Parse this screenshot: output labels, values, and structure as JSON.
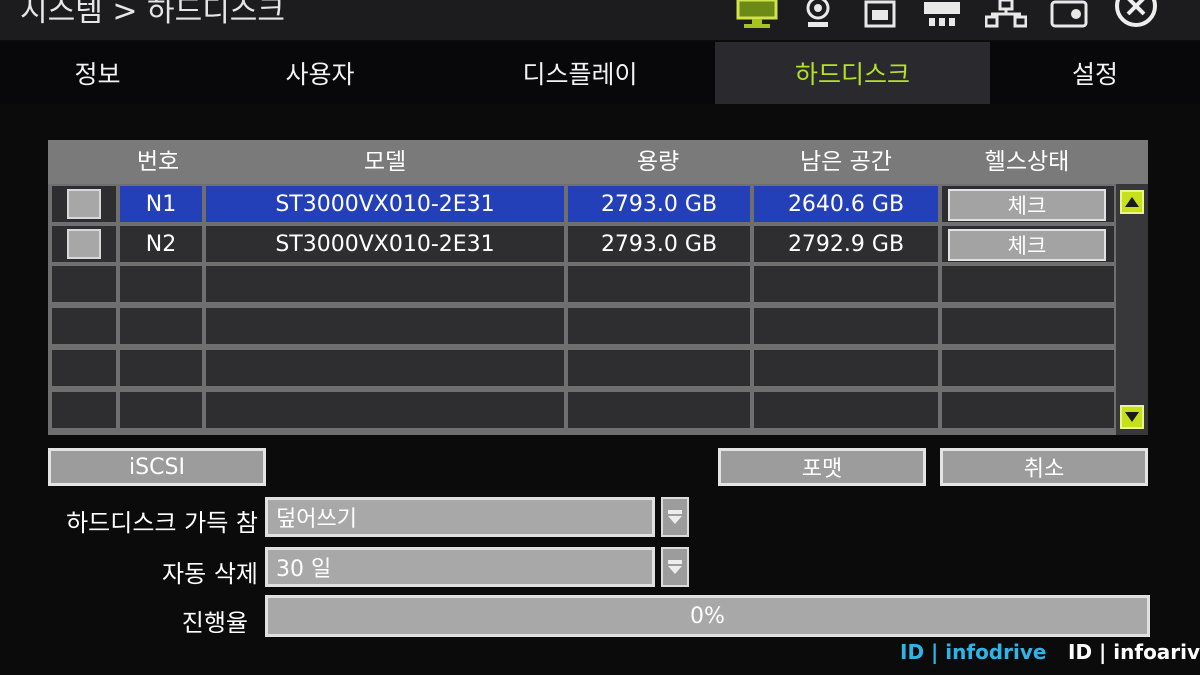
{
  "title": "시스템 > 하드디스크",
  "toolbar_icons": [
    "monitor-icon",
    "camera-icon",
    "recorder-icon",
    "network-card-icon",
    "network-icon",
    "storage-icon",
    "close-icon"
  ],
  "tabs": [
    {
      "label": "정보",
      "active": false
    },
    {
      "label": "사용자",
      "active": false
    },
    {
      "label": "디스플레이",
      "active": false
    },
    {
      "label": "하드디스크",
      "active": true
    },
    {
      "label": "설정",
      "active": false
    }
  ],
  "table": {
    "headers": [
      "",
      "번호",
      "모델",
      "용량",
      "남은 공간",
      "헬스상태"
    ],
    "rows": [
      {
        "num": "N1",
        "model": "ST3000VX010-2E31",
        "capacity": "2793.0 GB",
        "free": "2640.6 GB",
        "health": "체크",
        "selected": true
      },
      {
        "num": "N2",
        "model": "ST3000VX010-2E31",
        "capacity": "2793.0 GB",
        "free": "2792.9 GB",
        "health": "체크",
        "selected": false
      },
      {
        "num": "",
        "model": "",
        "capacity": "",
        "free": "",
        "health": "",
        "selected": false
      },
      {
        "num": "",
        "model": "",
        "capacity": "",
        "free": "",
        "health": "",
        "selected": false
      },
      {
        "num": "",
        "model": "",
        "capacity": "",
        "free": "",
        "health": "",
        "selected": false
      },
      {
        "num": "",
        "model": "",
        "capacity": "",
        "free": "",
        "health": "",
        "selected": false
      }
    ]
  },
  "buttons": {
    "iscsi": "iSCSI",
    "format": "포맷",
    "cancel": "취소"
  },
  "form": {
    "hdd_full_label": "하드디스크 가득 참",
    "hdd_full_value": "덮어쓰기",
    "auto_delete_label": "자동 삭제",
    "auto_delete_value": "30 일",
    "progress_label": "진행율",
    "progress_value": "0%",
    "progress_fraction": 0
  },
  "watermarks": [
    "ID | infodrive",
    "ID | infoarive"
  ],
  "colors": {
    "accent": "#b5e02a",
    "selection": "#2340b8",
    "scroll_button": "#c6e11c"
  }
}
